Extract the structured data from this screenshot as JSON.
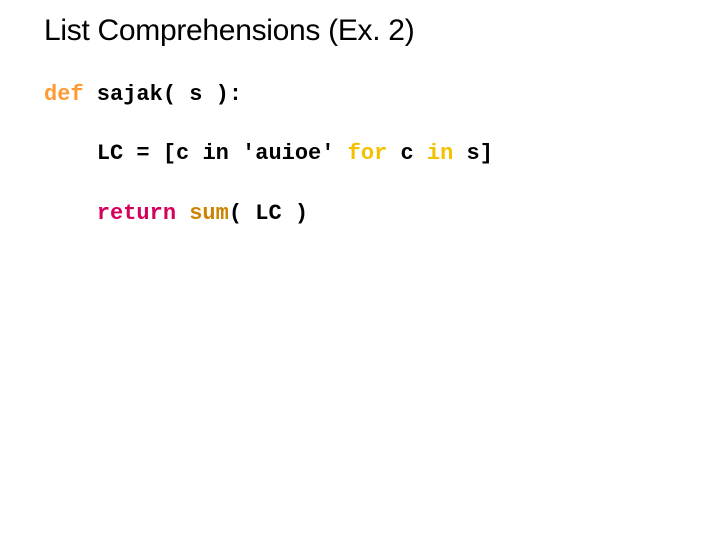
{
  "slide": {
    "title": "List Comprehensions (Ex. 2)"
  },
  "code": {
    "def": "def",
    "sig": " sajak( s ):",
    "indent": "    ",
    "lc_lhs": "LC = [c ",
    "in1": "in",
    "str": " 'auioe' ",
    "for": "for",
    "mid": " c ",
    "in2": "in",
    "tail": " s]",
    "ret": "return",
    "sp": " ",
    "sum": "sum",
    "args": "( LC )"
  }
}
